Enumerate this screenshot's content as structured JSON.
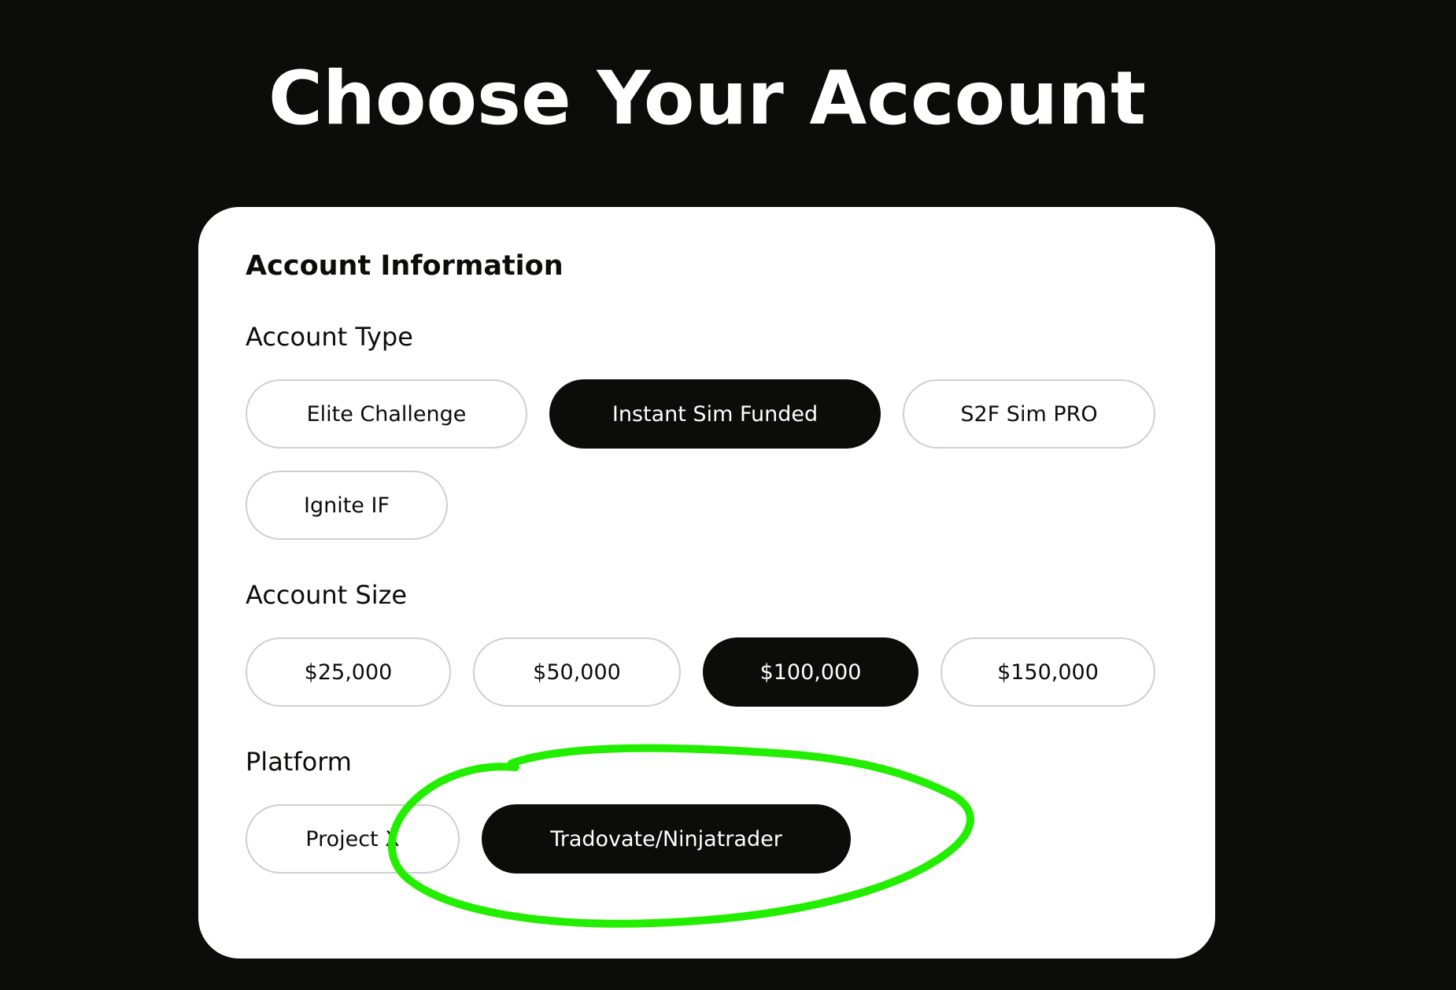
{
  "page": {
    "title": "Choose Your Account"
  },
  "card": {
    "heading": "Account Information"
  },
  "account_type": {
    "label": "Account Type",
    "options": [
      "Elite Challenge",
      "Instant Sim Funded",
      "S2F Sim PRO",
      "Ignite IF"
    ],
    "selected": "Instant Sim Funded"
  },
  "account_size": {
    "label": "Account Size",
    "options": [
      "$25,000",
      "$50,000",
      "$100,000",
      "$150,000"
    ],
    "selected": "$100,000"
  },
  "platform": {
    "label": "Platform",
    "options": [
      "Project X",
      "Tradovate/Ninjatrader"
    ],
    "selected": "Tradovate/Ninjatrader"
  },
  "colors": {
    "background": "#0c0d0b",
    "card": "#ffffff",
    "selected_pill": "#0c0d0b",
    "pill_border": "#cfcfcf",
    "annotation_marker": "#22ee00"
  }
}
